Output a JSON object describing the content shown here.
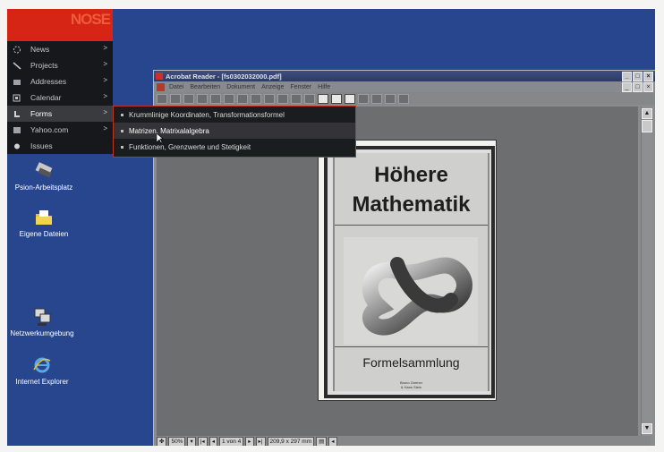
{
  "menu": {
    "logo": "NOSE",
    "items": [
      {
        "label": "News",
        "icon": "news-icon"
      },
      {
        "label": "Projects",
        "icon": "projects-icon"
      },
      {
        "label": "Addresses",
        "icon": "addresses-icon"
      },
      {
        "label": "Calendar",
        "icon": "calendar-icon"
      },
      {
        "label": "Forms",
        "icon": "forms-icon"
      },
      {
        "label": "Yahoo.com",
        "icon": "yahoo-icon"
      },
      {
        "label": "Issues",
        "icon": "issues-icon"
      }
    ],
    "arrow": ">",
    "submenu": [
      "Krummlinige Koordinaten, Transformationsformel",
      "Matrizen, Matrixalalgebra",
      "Funktionen, Grenzwerte und Stetigkeit"
    ]
  },
  "desktop": {
    "icons": [
      {
        "label": "Psion-Arbeitsplatz",
        "icon": "psion-icon"
      },
      {
        "label": "Eigene Dateien",
        "icon": "folder-icon"
      },
      {
        "label": "Netzwerkumgebung",
        "icon": "network-icon"
      },
      {
        "label": "Internet Explorer",
        "icon": "ie-icon"
      }
    ]
  },
  "acrobat": {
    "title": "Acrobat Reader - [fs0302032000.pdf]",
    "menubar": [
      "Datei",
      "Bearbeiten",
      "Dokument",
      "Anzeige",
      "Fenster",
      "Hilfe"
    ],
    "status": {
      "zoom": "50%",
      "page": "1 von 4",
      "size": "209,9 x 297 mm"
    },
    "document": {
      "title_line1": "Höhere",
      "title_line2": "Mathematik",
      "subtitle": "Formelsammlung",
      "authors_line1": "Bruno Greiner",
      "authors_line2": "& Hans Stein"
    }
  },
  "colors": {
    "desktop": "#27468e",
    "menu_bg": "#17181b",
    "accent": "#d62514",
    "viewer_bg": "#6d6e70"
  }
}
